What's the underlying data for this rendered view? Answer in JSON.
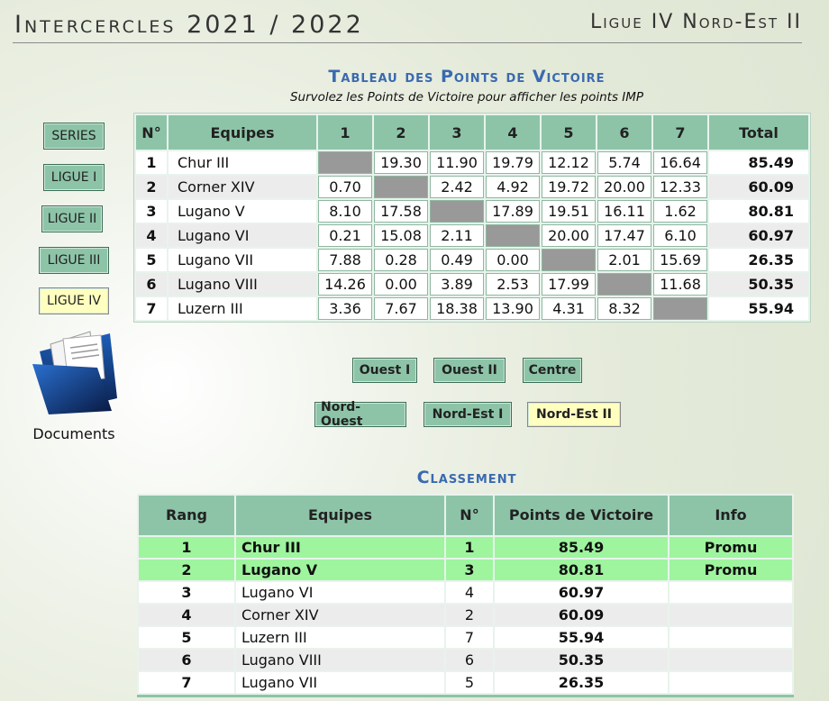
{
  "header": {
    "title": "Intercercles 2021 / 2022",
    "league": "Ligue IV Nord-Est II"
  },
  "sidebar": {
    "buttons": [
      "SERIES",
      "LIGUE I",
      "LIGUE II",
      "LIGUE III",
      "LIGUE IV"
    ],
    "active": "LIGUE IV",
    "documents_label": "Documents"
  },
  "vp": {
    "title": "Tableau des Points de Victoire",
    "subtitle": "Survolez les Points de Victoire pour afficher les points IMP",
    "headers": [
      "N°",
      "Equipes",
      "1",
      "2",
      "3",
      "4",
      "5",
      "6",
      "7",
      "Total"
    ],
    "rows": [
      {
        "n": "1",
        "team": "Chur III",
        "vals": [
          "",
          "19.30",
          "11.90",
          "19.79",
          "12.12",
          "5.74",
          "16.64"
        ],
        "total": "85.49"
      },
      {
        "n": "2",
        "team": "Corner XIV",
        "vals": [
          "0.70",
          "",
          "2.42",
          "4.92",
          "19.72",
          "20.00",
          "12.33"
        ],
        "total": "60.09"
      },
      {
        "n": "3",
        "team": "Lugano V",
        "vals": [
          "8.10",
          "17.58",
          "",
          "17.89",
          "19.51",
          "16.11",
          "1.62"
        ],
        "total": "80.81"
      },
      {
        "n": "4",
        "team": "Lugano VI",
        "vals": [
          "0.21",
          "15.08",
          "2.11",
          "",
          "20.00",
          "17.47",
          "6.10"
        ],
        "total": "60.97"
      },
      {
        "n": "5",
        "team": "Lugano VII",
        "vals": [
          "7.88",
          "0.28",
          "0.49",
          "0.00",
          "",
          "2.01",
          "15.69"
        ],
        "total": "26.35"
      },
      {
        "n": "6",
        "team": "Lugano VIII",
        "vals": [
          "14.26",
          "0.00",
          "3.89",
          "2.53",
          "17.99",
          "",
          "11.68"
        ],
        "total": "50.35"
      },
      {
        "n": "7",
        "team": "Luzern III",
        "vals": [
          "3.36",
          "7.67",
          "18.38",
          "13.90",
          "4.31",
          "8.32",
          ""
        ],
        "total": "55.94"
      }
    ]
  },
  "groups": {
    "row1": [
      "Ouest I",
      "Ouest II",
      "Centre"
    ],
    "row2": [
      "Nord-Ouest",
      "Nord-Est I",
      "Nord-Est II"
    ],
    "active": "Nord-Est II"
  },
  "ranking": {
    "title": "Classement",
    "headers": [
      "Rang",
      "Equipes",
      "N°",
      "Points de Victoire",
      "Info"
    ],
    "rows": [
      {
        "rang": "1",
        "team": "Chur III",
        "n": "1",
        "pts": "85.49",
        "info": "Promu"
      },
      {
        "rang": "2",
        "team": "Lugano V",
        "n": "3",
        "pts": "80.81",
        "info": "Promu"
      },
      {
        "rang": "3",
        "team": "Lugano VI",
        "n": "4",
        "pts": "60.97",
        "info": ""
      },
      {
        "rang": "4",
        "team": "Corner XIV",
        "n": "2",
        "pts": "60.09",
        "info": ""
      },
      {
        "rang": "5",
        "team": "Luzern III",
        "n": "7",
        "pts": "55.94",
        "info": ""
      },
      {
        "rang": "6",
        "team": "Lugano VIII",
        "n": "6",
        "pts": "50.35",
        "info": ""
      },
      {
        "rang": "7",
        "team": "Lugano VII",
        "n": "5",
        "pts": "26.35",
        "info": ""
      }
    ]
  }
}
